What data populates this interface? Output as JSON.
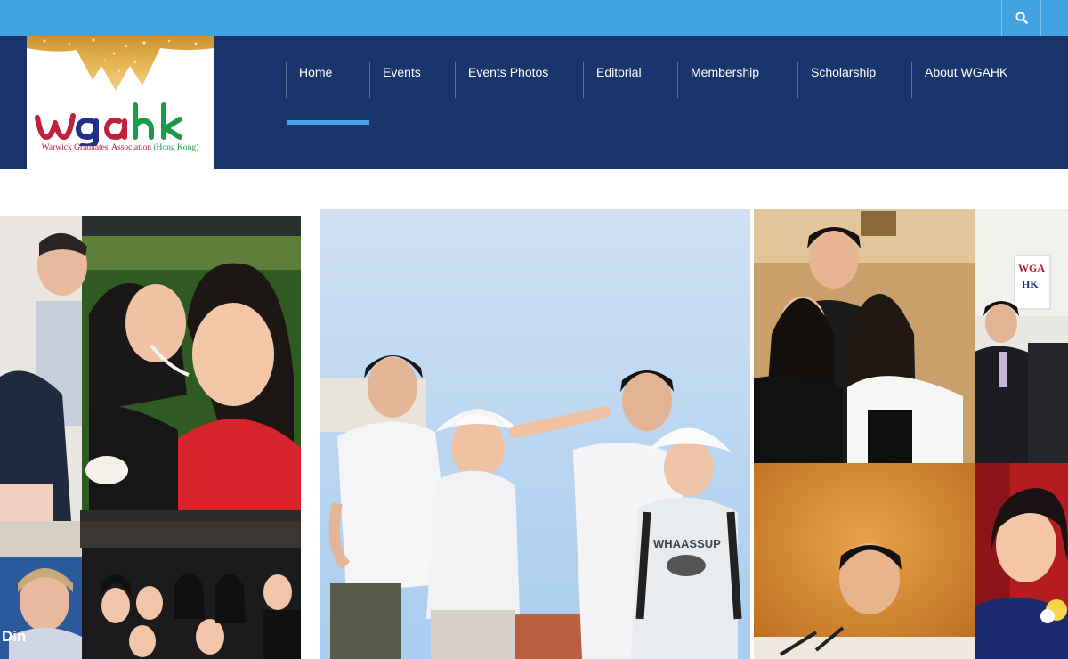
{
  "brand": {
    "logo_text": "wgahk",
    "logo_subtitle_main": "Warwick Graduates' Association",
    "logo_subtitle_hk": "(Hong Kong)",
    "colors": {
      "topbar": "#42a3e3",
      "header": "#19356b",
      "accent": "#42a3e3",
      "logo_red": "#c0213a",
      "logo_blue": "#1f2f8a",
      "logo_green": "#1d9a45"
    }
  },
  "topbar": {
    "search_icon": "search-icon"
  },
  "nav": {
    "items": [
      {
        "label": "Home",
        "active": true
      },
      {
        "label": "Events"
      },
      {
        "label": "Events Photos"
      },
      {
        "label": "Editorial"
      },
      {
        "label": "Membership"
      },
      {
        "label": "Scholarship"
      },
      {
        "label": "About WGAHK"
      }
    ]
  },
  "hero": {
    "sign_text_1": "WGA",
    "sign_text_2": "HK",
    "banner_text": "Din",
    "shirt_text": "WHAASSUP"
  }
}
